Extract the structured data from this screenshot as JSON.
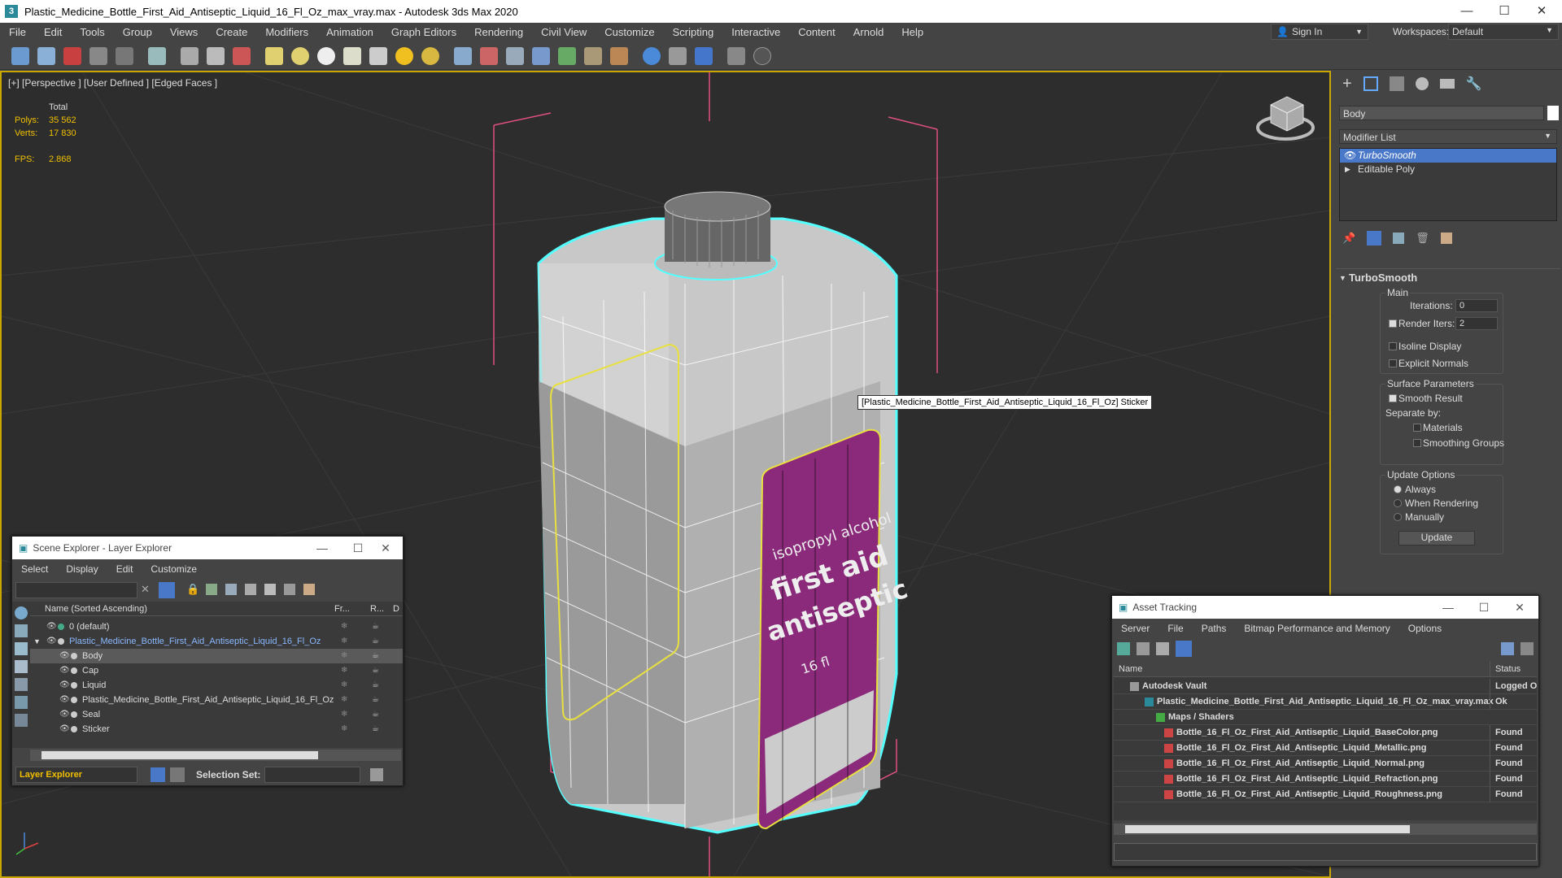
{
  "title": "Plastic_Medicine_Bottle_First_Aid_Antiseptic_Liquid_16_Fl_Oz_max_vray.max - Autodesk 3ds Max 2020",
  "app_icon": "3",
  "window_controls": {
    "minimize": "—",
    "maximize": "☐",
    "close": "✕"
  },
  "menu": [
    "File",
    "Edit",
    "Tools",
    "Group",
    "Views",
    "Create",
    "Modifiers",
    "Animation",
    "Graph Editors",
    "Rendering",
    "Civil View",
    "Customize",
    "Scripting",
    "Interactive",
    "Content",
    "Arnold",
    "Help"
  ],
  "signin": "Sign In",
  "workspaces_label": "Workspaces:",
  "workspace": "Default",
  "viewport": {
    "label": "[+] [Perspective ] [User Defined ] [Edged Faces ]",
    "stats_header": "Total",
    "polys_label": "Polys:",
    "polys": "35 562",
    "verts_label": "Verts:",
    "verts": "17 830",
    "fps_label": "FPS:",
    "fps": "2.868",
    "tooltip": "[Plastic_Medicine_Bottle_First_Aid_Antiseptic_Liquid_16_Fl_Oz] Sticker",
    "sticker_lines": [
      "isopropyl alcohol",
      "first aid",
      "antiseptic",
      "16 fl"
    ]
  },
  "cmdpanel": {
    "object_name": "Body",
    "modifier_list": "Modifier List",
    "stack": [
      "TurboSmooth",
      "Editable Poly"
    ],
    "rollout_title": "TurboSmooth",
    "main_label": "Main",
    "iterations_label": "Iterations:",
    "iterations": "0",
    "render_iters_label": "Render Iters:",
    "render_iters": "2",
    "isoline": "Isoline Display",
    "explicit_normals": "Explicit Normals",
    "surface_params": "Surface Parameters",
    "smooth_result": "Smooth Result",
    "separate_by": "Separate by:",
    "materials": "Materials",
    "smoothing_groups": "Smoothing Groups",
    "update_options": "Update Options",
    "always": "Always",
    "when_rendering": "When Rendering",
    "manually": "Manually",
    "update_btn": "Update"
  },
  "scene_explorer": {
    "title": "Scene Explorer - Layer Explorer",
    "menu": [
      "Select",
      "Display",
      "Edit",
      "Customize"
    ],
    "col_name": "Name (Sorted Ascending)",
    "col_fr": "Fr...",
    "col_r": "R...",
    "col_d": "D",
    "rows": [
      {
        "name": "0 (default)",
        "indent": 0
      },
      {
        "name": "Plastic_Medicine_Bottle_First_Aid_Antiseptic_Liquid_16_Fl_Oz",
        "indent": 1
      },
      {
        "name": "Body",
        "indent": 2
      },
      {
        "name": "Cap",
        "indent": 2
      },
      {
        "name": "Liquid",
        "indent": 2
      },
      {
        "name": "Plastic_Medicine_Bottle_First_Aid_Antiseptic_Liquid_16_Fl_Oz",
        "indent": 2
      },
      {
        "name": "Seal",
        "indent": 2
      },
      {
        "name": "Sticker",
        "indent": 2
      }
    ],
    "footer_explorer": "Layer Explorer",
    "selection_set_label": "Selection Set:"
  },
  "asset_tracking": {
    "title": "Asset Tracking",
    "menu": [
      "Server",
      "File",
      "Paths",
      "Bitmap Performance and Memory",
      "Options"
    ],
    "col_name": "Name",
    "col_status": "Status",
    "rows": [
      {
        "name": "Autodesk Vault",
        "status": "Logged O"
      },
      {
        "name": "Plastic_Medicine_Bottle_First_Aid_Antiseptic_Liquid_16_Fl_Oz_max_vray.max",
        "status": "Ok"
      },
      {
        "name": "Maps / Shaders",
        "status": ""
      },
      {
        "name": "Bottle_16_Fl_Oz_First_Aid_Antiseptic_Liquid_BaseColor.png",
        "status": "Found"
      },
      {
        "name": "Bottle_16_Fl_Oz_First_Aid_Antiseptic_Liquid_Metallic.png",
        "status": "Found"
      },
      {
        "name": "Bottle_16_Fl_Oz_First_Aid_Antiseptic_Liquid_Normal.png",
        "status": "Found"
      },
      {
        "name": "Bottle_16_Fl_Oz_First_Aid_Antiseptic_Liquid_Refraction.png",
        "status": "Found"
      },
      {
        "name": "Bottle_16_Fl_Oz_First_Aid_Antiseptic_Liquid_Roughness.png",
        "status": "Found"
      }
    ]
  },
  "colors": {
    "accent": "#4a78c8",
    "viewport_border": "#c8a800",
    "stats": "#f0c000",
    "wire_cyan": "#5ff",
    "sticker": "#8b2a7a"
  }
}
